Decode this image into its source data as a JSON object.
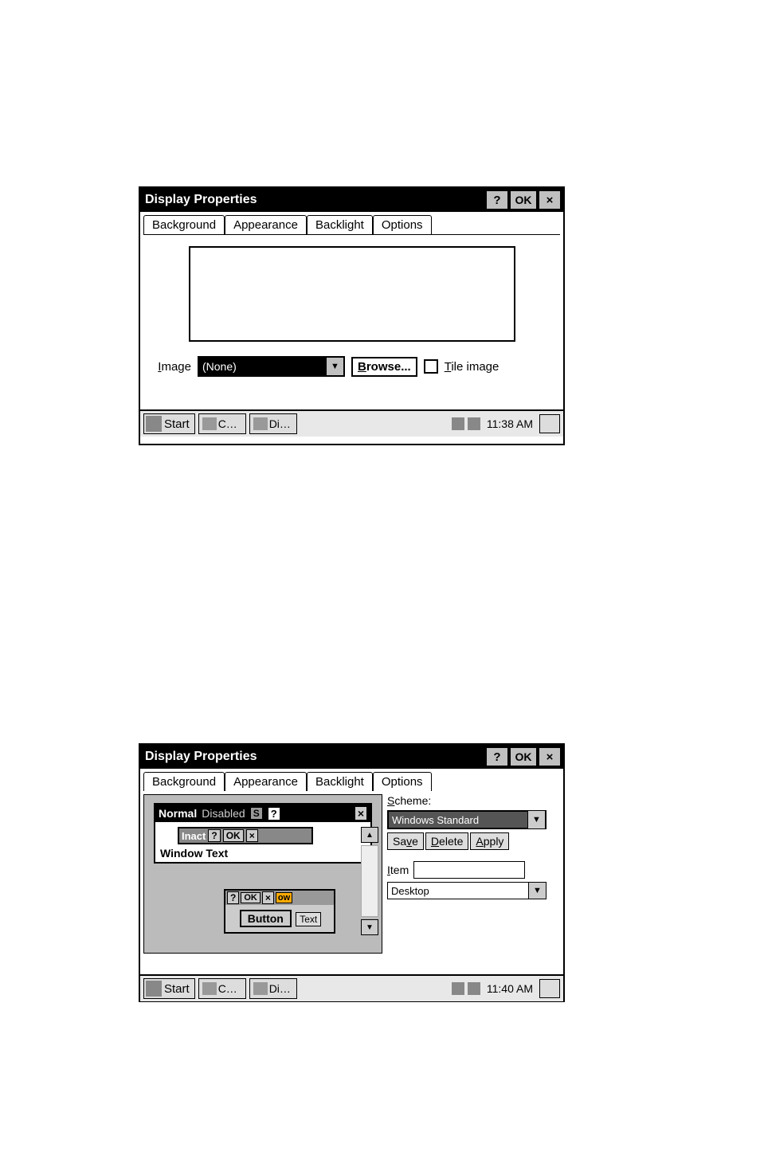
{
  "window1": {
    "title": "Display Properties",
    "titlebar": {
      "help": "?",
      "ok": "OK",
      "close": "×"
    },
    "tabs": [
      "Background",
      "Appearance",
      "Backlight",
      "Options"
    ],
    "active_tab": 0,
    "image_label": "Image",
    "image_value": "(None)",
    "browse_label": "Browse...",
    "tile_label": "Tile image"
  },
  "taskbar1": {
    "start": "Start",
    "tasks": [
      "C…",
      "Di…"
    ],
    "clock": "11:38 AM"
  },
  "window2": {
    "title": "Display Properties",
    "titlebar": {
      "help": "?",
      "ok": "OK",
      "close": "×"
    },
    "tabs": [
      "Background",
      "Appearance",
      "Backlight",
      "Options"
    ],
    "active_tab": 1,
    "preview": {
      "normal": "Normal",
      "disabled": "Disabled",
      "badge": "S",
      "q": "?",
      "x": "×",
      "inact": "Inact",
      "ok": "OK",
      "wintext": "Window Text",
      "button": "Button",
      "text_label": "Text",
      "ow": "ow"
    },
    "scheme_label": "Scheme:",
    "scheme_value": "Windows Standard",
    "save_label": "Save",
    "delete_label": "Delete",
    "apply_label": "Apply",
    "item_label": "Item",
    "item_value": "Desktop"
  },
  "taskbar2": {
    "start": "Start",
    "tasks": [
      "C…",
      "Di…"
    ],
    "clock": "11:40 AM"
  }
}
